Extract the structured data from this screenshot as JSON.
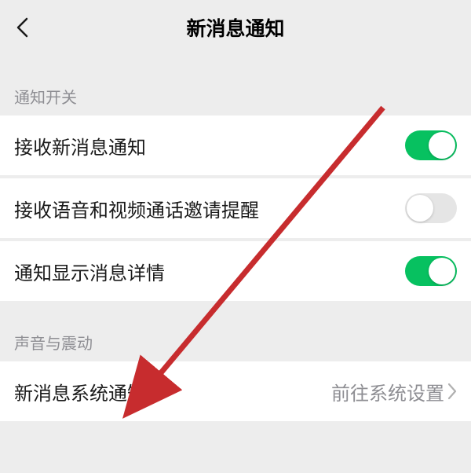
{
  "header": {
    "title": "新消息通知"
  },
  "section1": {
    "label": "通知开关",
    "items": [
      {
        "label": "接收新消息通知",
        "on": true
      },
      {
        "label": "接收语音和视频通话邀请提醒",
        "on": false
      },
      {
        "label": "通知显示消息详情",
        "on": true
      }
    ]
  },
  "section2": {
    "label": "声音与震动",
    "items": [
      {
        "label": "新消息系统通知",
        "value": "前往系统设置"
      }
    ]
  },
  "colors": {
    "accent": "#07c160",
    "arrow": "#c72c2e"
  }
}
